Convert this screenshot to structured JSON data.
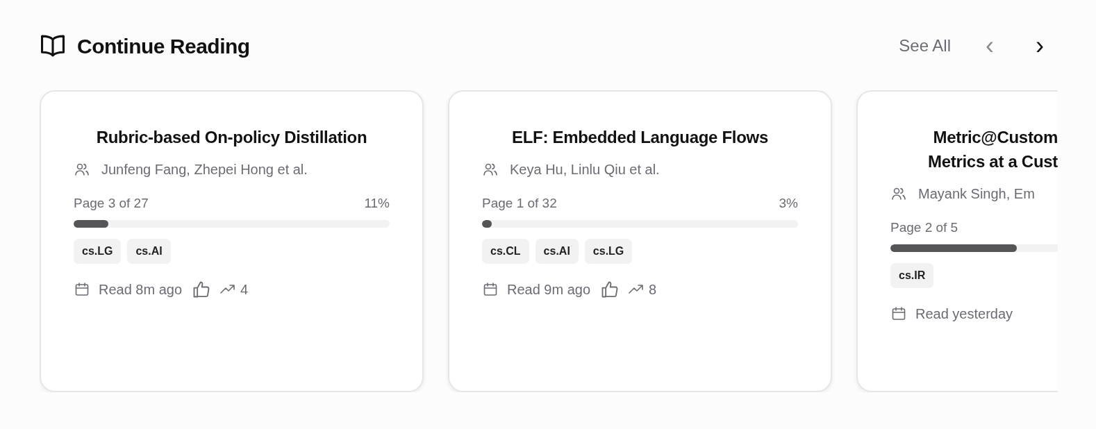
{
  "section": {
    "title": "Continue Reading",
    "see_all": "See All",
    "prev": "‹",
    "next": "›"
  },
  "cards": [
    {
      "title_lines": [
        "Rubric-based On-policy Distillation"
      ],
      "authors": "Junfeng Fang, Zhepei Hong et al.",
      "page": "Page 3 of 27",
      "percent": "11%",
      "level": 0.11,
      "tags": [
        "cs.LG",
        "cs.AI"
      ],
      "read": "Read 8m ago",
      "count": "4",
      "clipped": false
    },
    {
      "title_lines": [
        "ELF: Embedded Language Flows"
      ],
      "authors": "Keya Hu, Linlu Qiu et al.",
      "page": "Page 1 of 32",
      "percent": "3%",
      "level": 0.03,
      "tags": [
        "cs.CL",
        "cs.AI",
        "cs.LG"
      ],
      "read": "Read 9m ago",
      "count": "8",
      "clipped": false
    },
    {
      "title_lines": [
        "Metric@Custom",
        "Metrics at a Cust"
      ],
      "authors": "Mayank Singh, Em",
      "page": "Page 2 of 5",
      "level": 0.4,
      "tags": [
        "cs.IR"
      ],
      "read": "Read yesterday",
      "clipped": true
    }
  ]
}
